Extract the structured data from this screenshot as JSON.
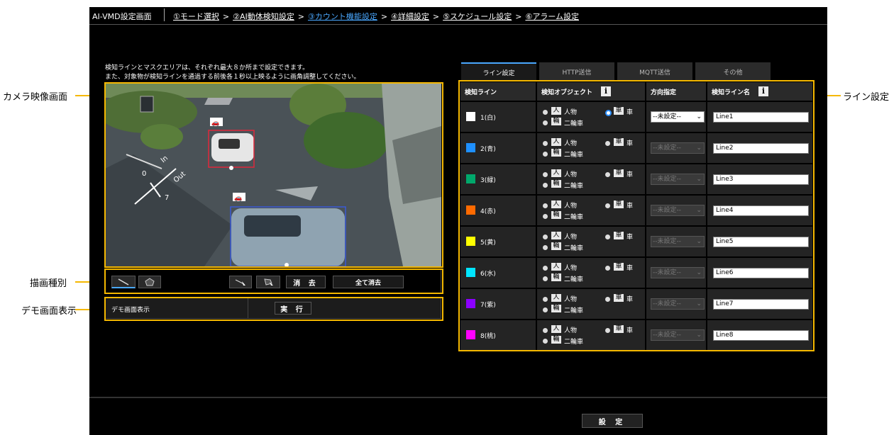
{
  "header": {
    "title": "AI-VMD設定画面",
    "steps": [
      {
        "label": "①モード選択",
        "active": false
      },
      {
        "label": "②AI動体検知設定",
        "active": false
      },
      {
        "label": "③カウント機能設定",
        "active": true
      },
      {
        "label": "④詳細設定",
        "active": false
      },
      {
        "label": "⑤スケジュール設定",
        "active": false
      },
      {
        "label": "⑥アラーム設定",
        "active": false
      }
    ],
    "separator": ">"
  },
  "notice": {
    "line1": "検知ラインとマスクエリアは、それぞれ最大８か所まで設定できます。",
    "line2": "また、対象物が検知ラインを通過する前後各１秒以上映るように画角調整してください。"
  },
  "camera": {
    "line_label_in": "In",
    "line_label_out": "Out",
    "line_label_0": "0",
    "line_label_7": "7"
  },
  "toolbar": {
    "erase_label": "消 去",
    "erase_all_label": "全て消去"
  },
  "demo": {
    "label": "デモ画面表示",
    "run_label": "実 行"
  },
  "tabs": [
    "ライン設定",
    "HTTP送信",
    "MQTT送信",
    "その他"
  ],
  "table": {
    "headers": {
      "line": "検知ライン",
      "object": "検知オブジェクト",
      "direction": "方向指定",
      "name": "検知ライン名"
    },
    "object_labels": {
      "person": "人物",
      "car": "車",
      "bike": "二輪車"
    },
    "rows": [
      {
        "line": "1(白)",
        "color": "#ffffff",
        "direction": "--未設定--",
        "name": "Line1",
        "enabled": true
      },
      {
        "line": "2(青)",
        "color": "#1e90ff",
        "direction": "--未設定--",
        "name": "Line2",
        "enabled": false
      },
      {
        "line": "3(緑)",
        "color": "#00a86b",
        "direction": "--未設定--",
        "name": "Line3",
        "enabled": false
      },
      {
        "line": "4(赤)",
        "color": "#ff6a00",
        "direction": "--未設定--",
        "name": "Line4",
        "enabled": false
      },
      {
        "line": "5(黄)",
        "color": "#ffff00",
        "direction": "--未設定--",
        "name": "Line5",
        "enabled": false
      },
      {
        "line": "6(水)",
        "color": "#00e5ff",
        "direction": "--未設定--",
        "name": "Line6",
        "enabled": false
      },
      {
        "line": "7(紫)",
        "color": "#8b00ff",
        "direction": "--未設定--",
        "name": "Line7",
        "enabled": false
      },
      {
        "line": "8(桃)",
        "color": "#ff00ff",
        "direction": "--未設定--",
        "name": "Line8",
        "enabled": false
      }
    ]
  },
  "footer": {
    "set_label": "設 定"
  },
  "callouts": {
    "camera": "カメラ映像画面",
    "draw_type": "描画種別",
    "demo": "デモ画面表示",
    "line_settings": "ライン設定"
  },
  "colors": {
    "accent_yellow": "#f5b800",
    "active_tab": "#4aa8ff"
  }
}
